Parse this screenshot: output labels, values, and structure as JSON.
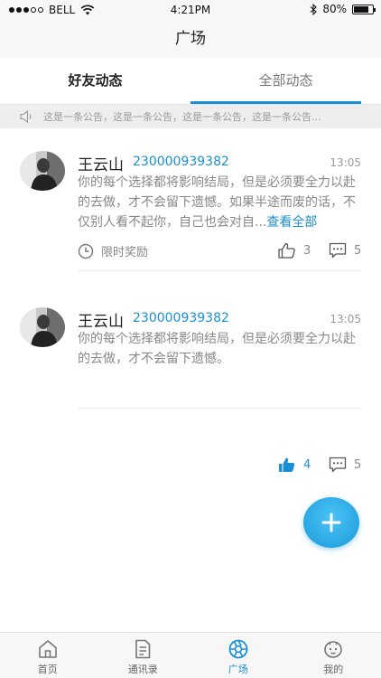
{
  "status_bar": {
    "carrier": "BELL",
    "time": "4:21PM",
    "battery": "80%",
    "battery_level": 0.8
  },
  "nav": {
    "title": "广场"
  },
  "tabs": [
    {
      "label": "好友动态"
    },
    {
      "label": "全部动态"
    }
  ],
  "notice": {
    "text": "这是一条公告，这是一条公告，这是一条公告，这是一条公告..."
  },
  "posts": [
    {
      "username": "王云山",
      "user_id": "230000939382",
      "time": "13:05",
      "content": "你的每个选择都将影响结局，但是必须要全力以赴的去做，才不会留下遗憾。如果半途而废的话，不仅别人看不起你，自己也会对自...",
      "more_label": "查看全部",
      "reward_label": "限时奖励",
      "likes": "3",
      "comments": "5",
      "liked": false
    },
    {
      "username": "王云山",
      "user_id": "230000939382",
      "time": "13:05",
      "content": "你的每个选择都将影响结局，但是必须要全力以赴的去做，才不会留下遗憾。",
      "likes": "4",
      "comments": "5",
      "liked": true
    }
  ],
  "tab_bar": [
    {
      "label": "首页",
      "icon": "home-icon"
    },
    {
      "label": "通讯录",
      "icon": "contacts-icon"
    },
    {
      "label": "广场",
      "icon": "aperture-icon",
      "active": true
    },
    {
      "label": "我的",
      "icon": "profile-icon"
    }
  ],
  "colors": {
    "accent": "#1a8fd6",
    "fab": "#29a8e8"
  }
}
